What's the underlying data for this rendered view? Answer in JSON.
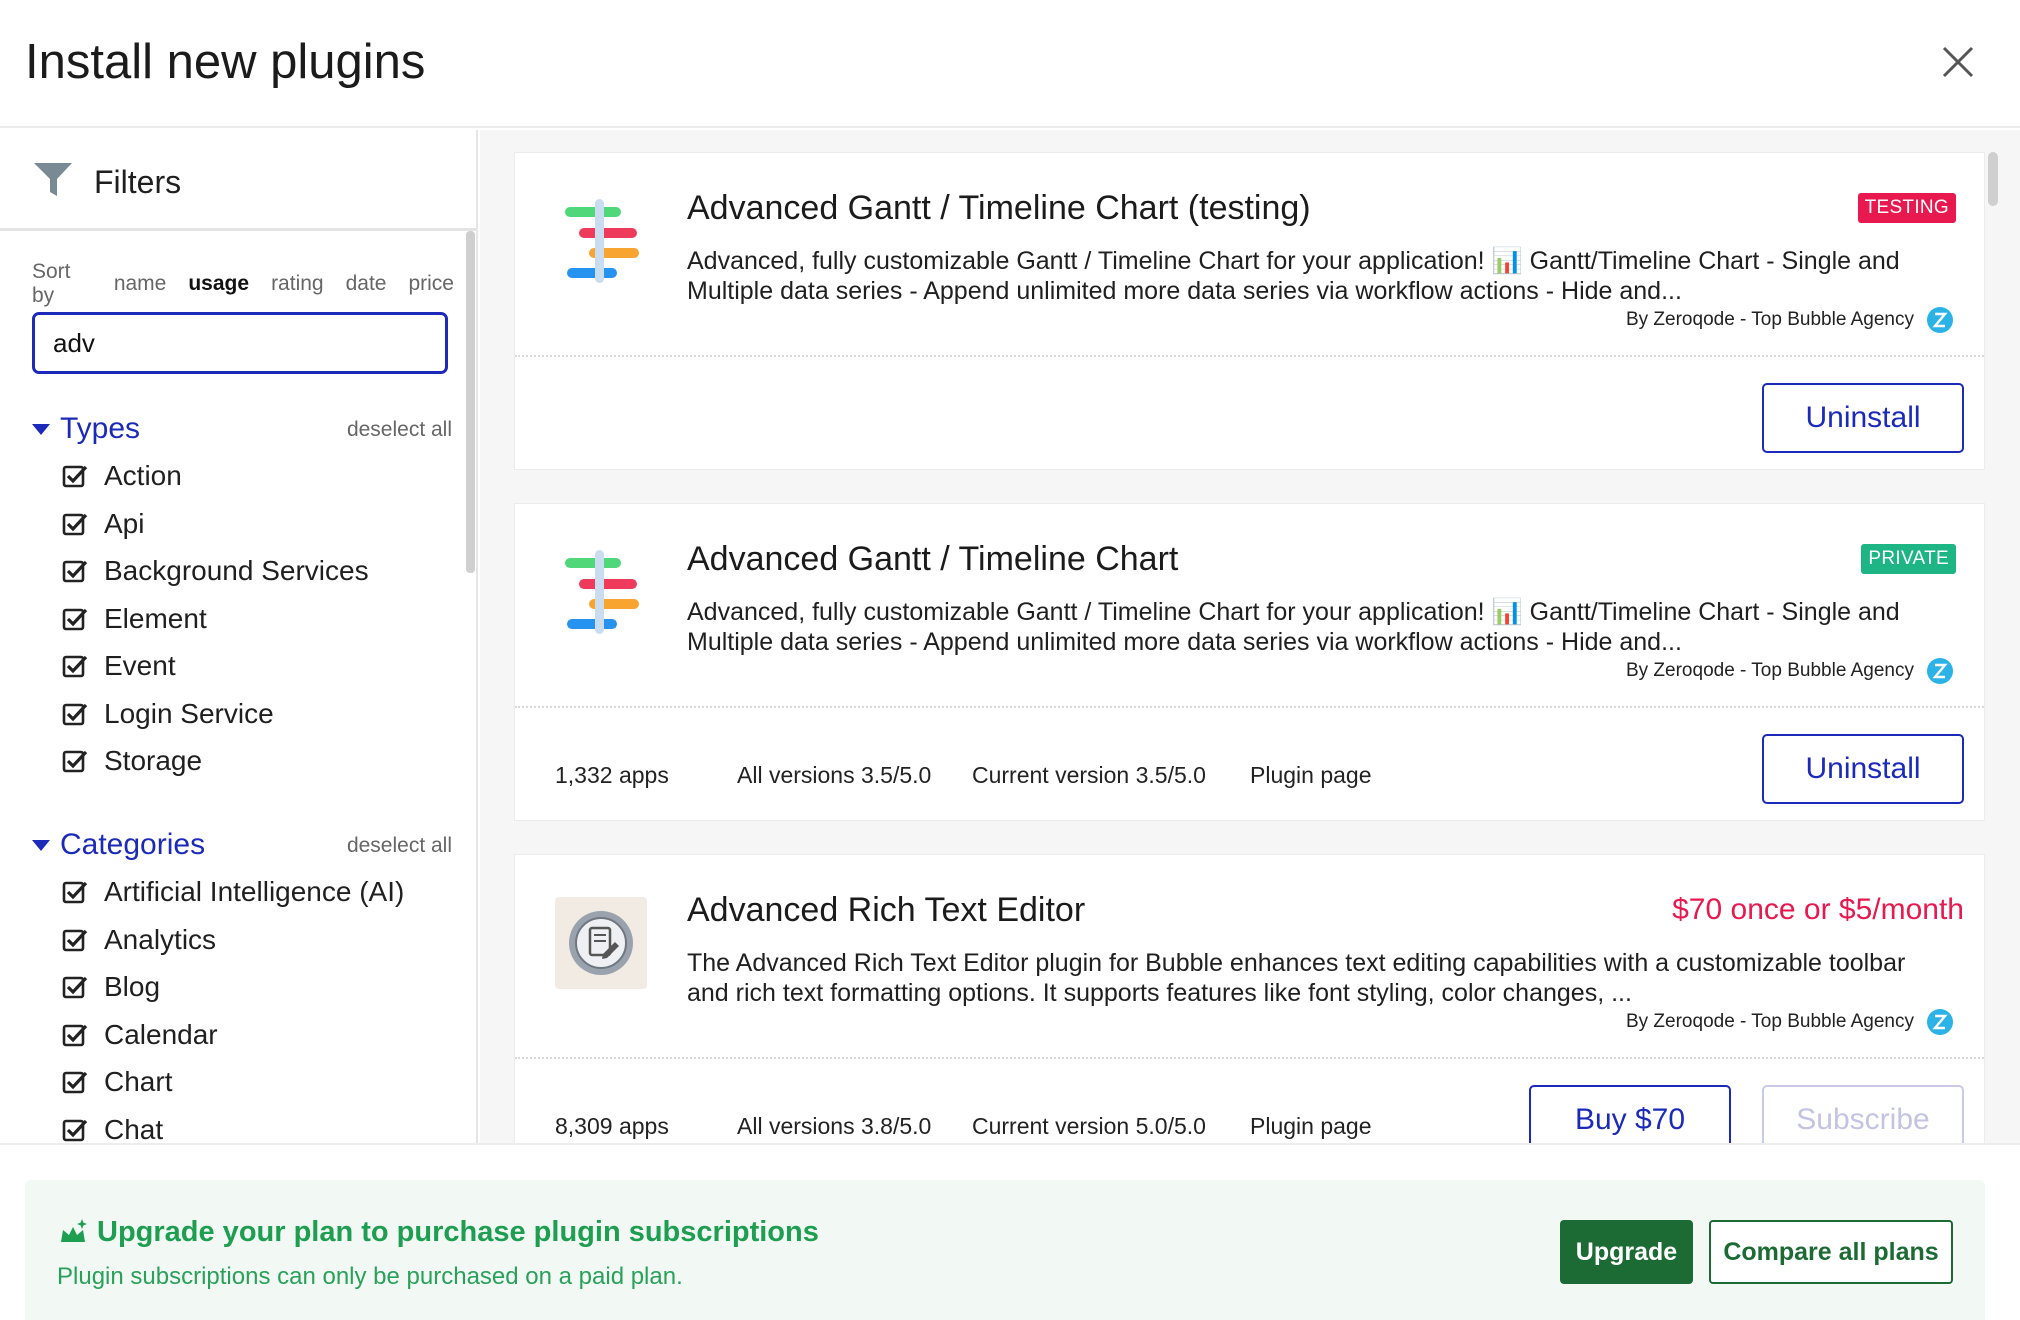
{
  "header": {
    "title": "Install new plugins",
    "close_icon": "close-icon"
  },
  "filters": {
    "label": "Filters",
    "icon": "filter-icon",
    "sort_by_label": "Sort by",
    "sort_options": [
      "name",
      "usage",
      "rating",
      "date",
      "price"
    ],
    "active_sort": "usage",
    "search_value": "adv"
  },
  "types": {
    "title": "Types",
    "deselect_label": "deselect all",
    "items": [
      "Action",
      "Api",
      "Background Services",
      "Element",
      "Event",
      "Login Service",
      "Storage"
    ]
  },
  "categories": {
    "title": "Categories",
    "deselect_label": "deselect all",
    "items": [
      "Artificial Intelligence (AI)",
      "Analytics",
      "Blog",
      "Calendar",
      "Chart",
      "Chat"
    ]
  },
  "plugins": [
    {
      "title": "Advanced Gantt / Timeline Chart (testing)",
      "badge": "TESTING",
      "description": "Advanced, fully customizable Gantt / Timeline Chart for your application! 📊 Gantt/Timeline Chart - Single and Multiple data series - Append unlimited more data series via workflow actions - Hide and...",
      "byline": "By Zeroqode - Top Bubble Agency",
      "button": "Uninstall"
    },
    {
      "title": "Advanced Gantt / Timeline Chart",
      "badge": "PRIVATE",
      "description": "Advanced, fully customizable Gantt / Timeline Chart for your application! 📊 Gantt/Timeline Chart - Single and Multiple data series - Append unlimited more data series via workflow actions - Hide and...",
      "byline": "By Zeroqode - Top Bubble Agency",
      "apps": "1,332 apps",
      "all_versions": "All versions 3.5/5.0",
      "current_version": "Current version 3.5/5.0",
      "plugin_page": "Plugin page",
      "button": "Uninstall"
    },
    {
      "title": "Advanced Rich Text Editor",
      "price": "$70 once or $5/month",
      "description": "The Advanced Rich Text Editor plugin for Bubble enhances text editing capabilities with a customizable toolbar and rich text formatting options. It supports features like font styling, color changes, ...",
      "byline": "By Zeroqode - Top Bubble Agency",
      "apps": "8,309 apps",
      "all_versions": "All versions 3.8/5.0",
      "current_version": "Current version 5.0/5.0",
      "plugin_page": "Plugin page",
      "buy_button": "Buy $70",
      "subscribe_button": "Subscribe"
    }
  ],
  "banner": {
    "title": "Upgrade your plan to purchase plugin subscriptions",
    "subtitle": "Plugin subscriptions can only be purchased on a paid plan.",
    "upgrade_button": "Upgrade",
    "compare_button": "Compare all plans",
    "icon": "sparkle-crown-icon"
  },
  "colors": {
    "accent": "#1b2ab8",
    "testing": "#e8194f",
    "private": "#1db584",
    "upgrade_green": "#1c6b34",
    "banner_text": "#1e9e50"
  }
}
